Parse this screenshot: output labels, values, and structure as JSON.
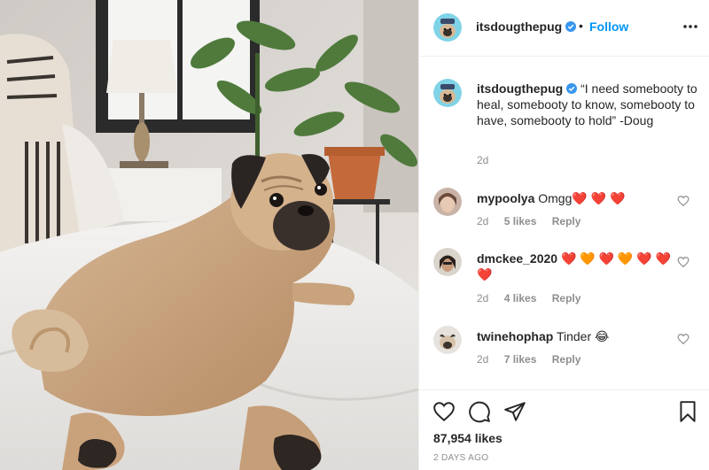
{
  "post": {
    "username": "itsdougthepug",
    "follow_label": "Follow",
    "separator": "•",
    "caption": "“I need somebooty to heal, somebooty to know, somebooty to have, somebooty to hold” -Doug",
    "time": "2d",
    "likes": "87,954 likes",
    "posted_ago": "2 DAYS AGO"
  },
  "comments": [
    {
      "username": "mypoolya",
      "text": "Omgg❤️ ❤️ ❤️",
      "time": "2d",
      "likes": "5 likes",
      "reply": "Reply"
    },
    {
      "username": "dmckee_2020",
      "text": "❤️ 🧡 ❤️ 🧡 ❤️ ❤️ ❤️",
      "time": "2d",
      "likes": "4 likes",
      "reply": "Reply"
    },
    {
      "username": "twinehophap",
      "text": "Tinder 😂",
      "time": "2d",
      "likes": "7 likes",
      "reply": "Reply"
    }
  ],
  "icons": {
    "verified": "verified-badge-icon",
    "more": "more-options-icon",
    "like": "heart-icon",
    "comment": "comment-icon",
    "share": "share-icon",
    "save": "bookmark-icon"
  },
  "colors": {
    "link": "#0095f6",
    "muted": "#8e8e8e",
    "text": "#262626",
    "border": "#efefef"
  }
}
